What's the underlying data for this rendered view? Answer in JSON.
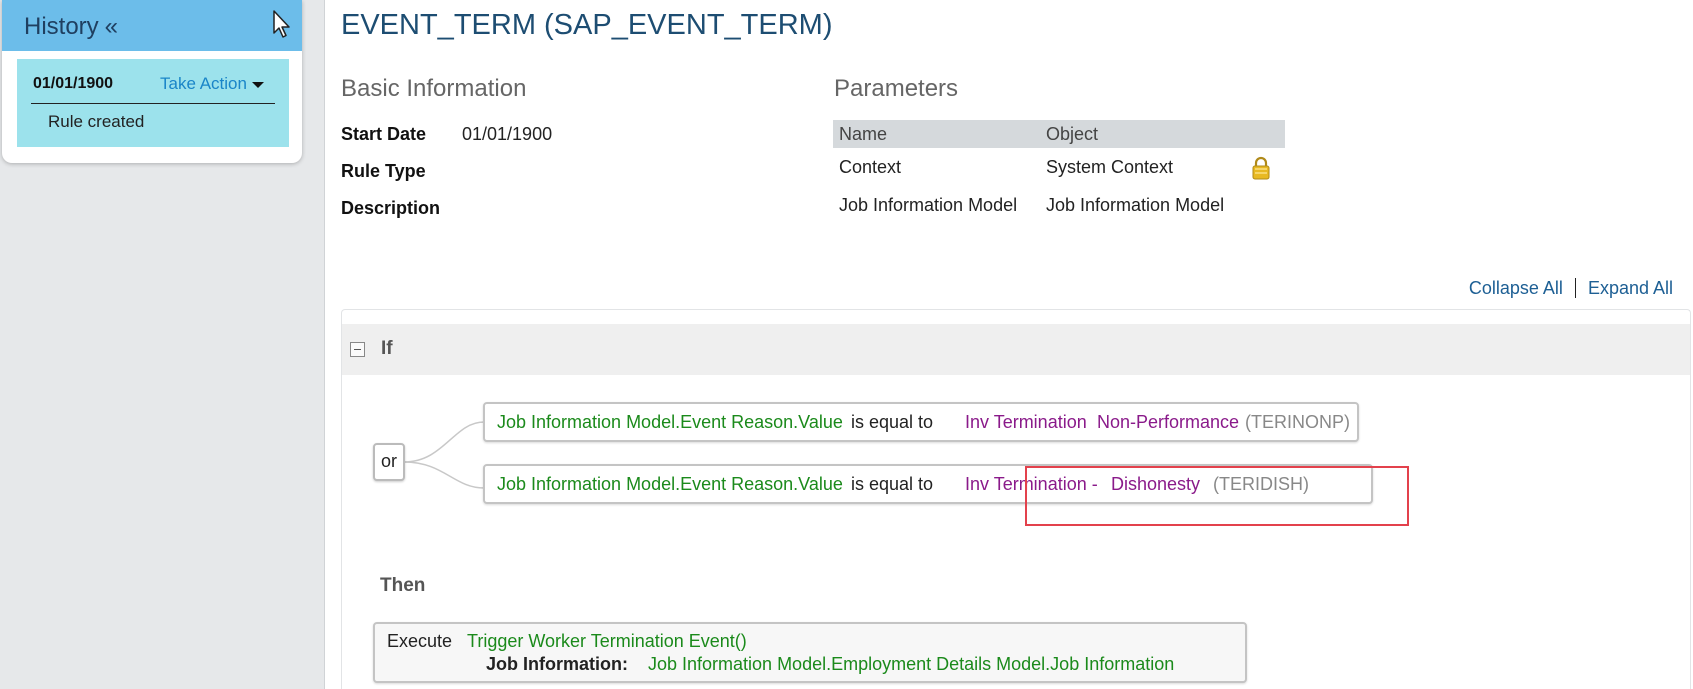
{
  "history": {
    "title": "History",
    "toggle": "«",
    "entry": {
      "date": "01/01/1900",
      "action_label": "Take Action",
      "description": "Rule created"
    }
  },
  "rule": {
    "title": "EVENT_TERM (SAP_EVENT_TERM)",
    "basic_info": {
      "heading": "Basic Information",
      "start_date_label": "Start Date",
      "start_date_value": "01/01/1900",
      "rule_type_label": "Rule Type",
      "description_label": "Description"
    },
    "parameters": {
      "heading": "Parameters",
      "columns": [
        "Name",
        "Object"
      ],
      "rows": [
        {
          "name": "Context",
          "object": "System Context",
          "locked": true
        },
        {
          "name": "Job Information Model",
          "object": "Job Information Model",
          "locked": false
        }
      ]
    },
    "collapse_all": "Collapse All",
    "expand_all": "Expand All",
    "if_label": "If",
    "or_label": "or",
    "conditions": [
      {
        "field": "Job Information Model.Event Reason.Value",
        "operator": "is equal to",
        "value_a": "Inv Termination",
        "value_b": "Non-Performance",
        "code": "(TERINONP)"
      },
      {
        "field": "Job Information Model.Event Reason.Value",
        "operator": "is equal to",
        "value_a": "Inv Termination -",
        "value_b": "Dishonesty",
        "code": "(TERIDISH)"
      }
    ],
    "then_label": "Then",
    "execute": {
      "label": "Execute",
      "function": "Trigger Worker Termination Event()",
      "param_label": "Job Information:",
      "param_value": "Job Information Model.Employment Details Model.Job Information"
    }
  },
  "colors": {
    "accent": "#6cbdea",
    "history_entry_bg": "#9ce2ec",
    "title_blue": "#1d4d72",
    "link_blue": "#1d5f94",
    "field_green": "#1b8a1b",
    "value_purple": "#8a1a8a",
    "highlight_red": "#e3414c"
  }
}
